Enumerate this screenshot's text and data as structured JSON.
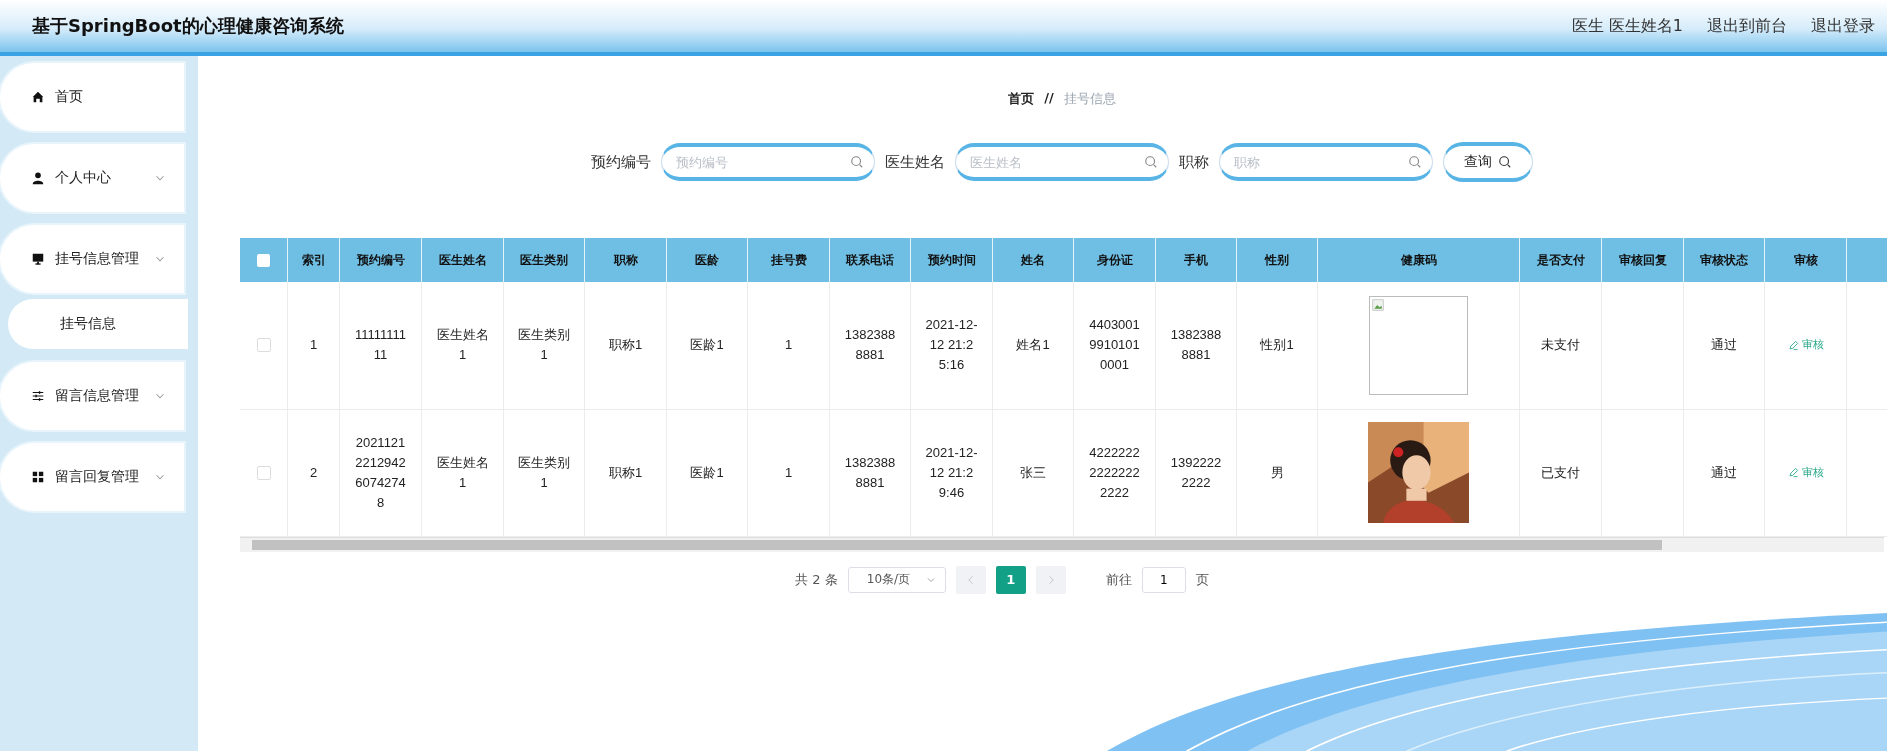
{
  "header": {
    "title": "基于SpringBoot的心理健康咨询系统",
    "links": [
      "医生 医生姓名1",
      "退出到前台",
      "退出登录"
    ]
  },
  "sidebar": {
    "items": [
      {
        "label": "首页",
        "expandable": false
      },
      {
        "label": "个人中心",
        "expandable": true
      },
      {
        "label": "挂号信息管理",
        "expandable": true,
        "children": [
          {
            "label": "挂号信息"
          }
        ]
      },
      {
        "label": "留言信息管理",
        "expandable": true
      },
      {
        "label": "留言回复管理",
        "expandable": true
      }
    ]
  },
  "breadcrumb": [
    "首页",
    "//",
    "挂号信息"
  ],
  "search": {
    "fields": [
      {
        "label": "预约编号",
        "placeholder": "预约编号"
      },
      {
        "label": "医生姓名",
        "placeholder": "医生姓名"
      },
      {
        "label": "职称",
        "placeholder": "职称"
      }
    ],
    "button": "查询"
  },
  "table": {
    "all_checked": false,
    "columns": [
      "索引",
      "预约编号",
      "医生姓名",
      "医生类别",
      "职称",
      "医龄",
      "挂号费",
      "联系电话",
      "预约时间",
      "姓名",
      "身份证",
      "手机",
      "性别",
      "健康码",
      "是否支付",
      "审核回复",
      "审核状态",
      "审核"
    ],
    "rows": [
      {
        "checked": false,
        "cells": [
          "1",
          "1111111111",
          "医生姓名1",
          "医生类别1",
          "职称1",
          "医龄1",
          "1",
          "13823888881",
          "2021-12-12 21:25:16",
          "姓名1",
          "440300199101010001",
          "13823888881",
          "性别1"
        ],
        "health_code": {
          "kind": "broken"
        },
        "paid": "未支付",
        "status": "通过",
        "action": "审核"
      },
      {
        "checked": false,
        "cells": [
          "2",
          "2021121221294260742748",
          "医生姓名1",
          "医生类别1",
          "职称1",
          "医龄1",
          "1",
          "13823888881",
          "2021-12-12 21:29:46",
          "张三",
          "422222222222222222",
          "13922222222",
          "男"
        ],
        "paid": "已支付",
        "status": "通过",
        "action": "审核"
      }
    ]
  },
  "pagination": {
    "total": "共 2 条",
    "page_size": "10条/页",
    "pages": [
      {
        "label": "1",
        "selected": true
      }
    ],
    "goto_label": "前往",
    "goto_value": "1",
    "goto_suffix": "页"
  }
}
